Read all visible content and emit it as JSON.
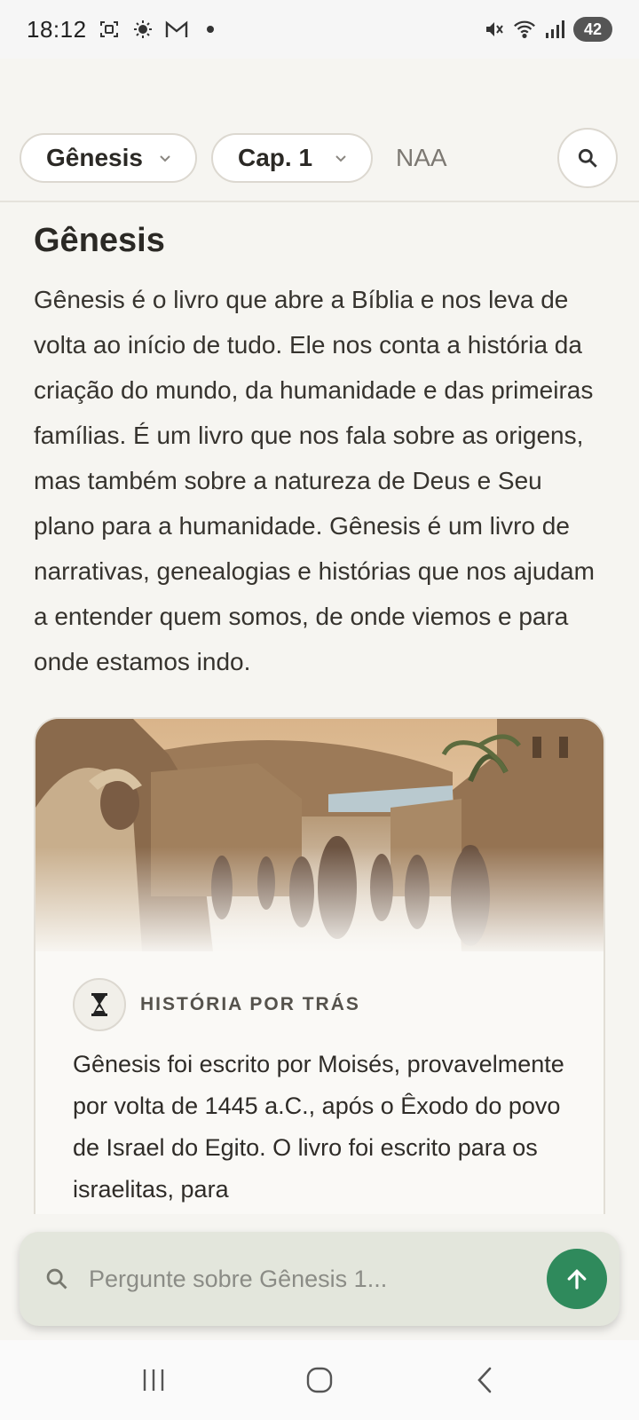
{
  "status_bar": {
    "time": "18:12",
    "battery": "42",
    "icons": [
      "screenshot-icon",
      "brightness-icon",
      "gmail-icon",
      "notification-dot-icon",
      "mute-icon",
      "wifi-icon",
      "signal-icon",
      "battery-icon"
    ]
  },
  "toolbar": {
    "book": "Gênesis",
    "chapter": "Cap. 1",
    "version": "NAA"
  },
  "content": {
    "title": "Gênesis",
    "intro": "Gênesis é o livro que abre a Bíblia e nos leva de volta ao início de tudo. Ele nos conta a história da criação do mundo, da humanidade e das primeiras famílias. É um livro que nos fala sobre as origens, mas também sobre a natureza de Deus e Seu plano para a humanidade. Gênesis é um livro de narrativas, genealogias e histórias que nos ajudam a entender quem somos, de onde viemos e para onde estamos indo."
  },
  "card": {
    "label": "HISTÓRIA POR TRÁS",
    "text": "Gênesis foi escrito por Moisés, provavelmente por volta de 1445 a.C., após o Êxodo do povo de Israel do Egito. O livro foi escrito para os israelitas, para"
  },
  "ask_bar": {
    "placeholder": "Pergunte sobre Gênesis 1..."
  },
  "colors": {
    "background": "#f6f5f1",
    "accent": "#2f8a5c",
    "ask_bar": "#e3e6dc"
  }
}
